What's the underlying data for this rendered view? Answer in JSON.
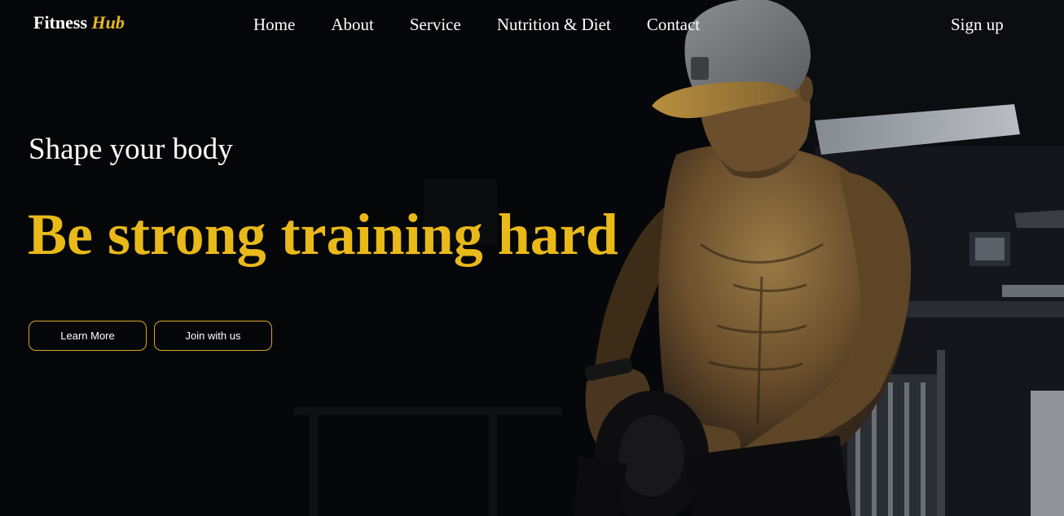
{
  "navbar": {
    "logo_primary": "Fitness",
    "logo_accent": "Hub",
    "links": [
      {
        "label": "Home"
      },
      {
        "label": "About"
      },
      {
        "label": "Service"
      },
      {
        "label": "Nutrition & Diet"
      },
      {
        "label": "Contact"
      }
    ],
    "signup_label": "Sign up"
  },
  "hero": {
    "subtitle": "Shape your body",
    "headline": "Be strong training hard",
    "learn_more_label": "Learn More",
    "join_label": "Join with us"
  },
  "colors": {
    "accent": "#e8b919",
    "background": "#070709",
    "button_border": "#d9a52a"
  }
}
